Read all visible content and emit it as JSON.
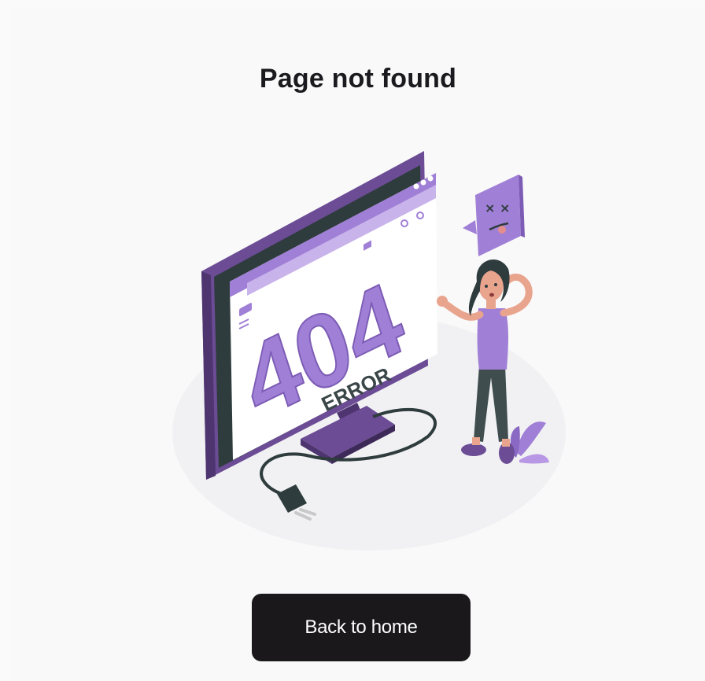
{
  "page": {
    "title": "Page not found"
  },
  "illustration": {
    "big_text": "404",
    "sub_text": "ERROR"
  },
  "actions": {
    "home_label": "Back to home"
  },
  "colors": {
    "accent": "#a07fd6",
    "accent_dark": "#6b4c95",
    "button_bg": "#1a181b"
  }
}
